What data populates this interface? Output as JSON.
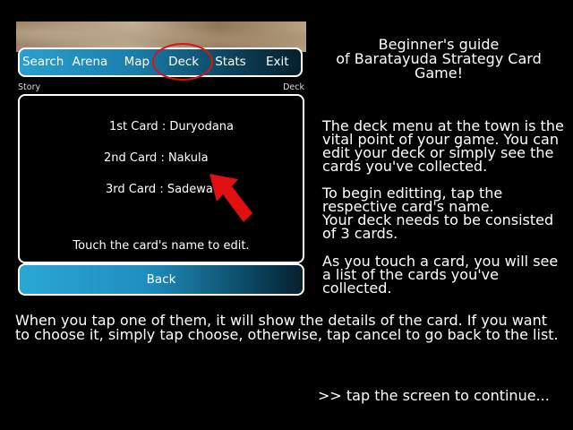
{
  "nav": {
    "items": [
      "Search",
      "Arena",
      "Map",
      "Deck",
      "Stats",
      "Exit"
    ]
  },
  "subbar": {
    "left": "Story",
    "right": "Deck"
  },
  "deck": {
    "cards": [
      "1st Card : Duryodana",
      "2nd Card : Nakula",
      "3rd Card : Sadewa"
    ],
    "hint": "Touch the card's name to edit.",
    "back_label": "Back"
  },
  "guide": {
    "title_line1": "Beginner's guide",
    "title_line2": "of Baratayuda Strategy Card",
    "title_line3": "Game!",
    "para1": "The deck menu at the town is the vital point of your game. You can edit your deck or simply see the cards you've collected.",
    "para2a": "To begin editting, tap the respective card's name.",
    "para2b": "Your deck needs to be consisted of 3 cards.",
    "para3": "As you touch a card, you will see a list of the cards you've collected.",
    "bottom": "When you tap one of them, it will show the details of the card. If you want to choose it, simply tap choose, otherwise, tap cancel to go back to the list.",
    "continue": ">> tap the screen to continue..."
  },
  "colors": {
    "highlight": "#e01010",
    "arrow": "#e01010",
    "nav_gradient_start": "#2aa0cf",
    "nav_gradient_end": "#061f2d"
  },
  "icons": {
    "pointer": "red-arrow-icon"
  }
}
